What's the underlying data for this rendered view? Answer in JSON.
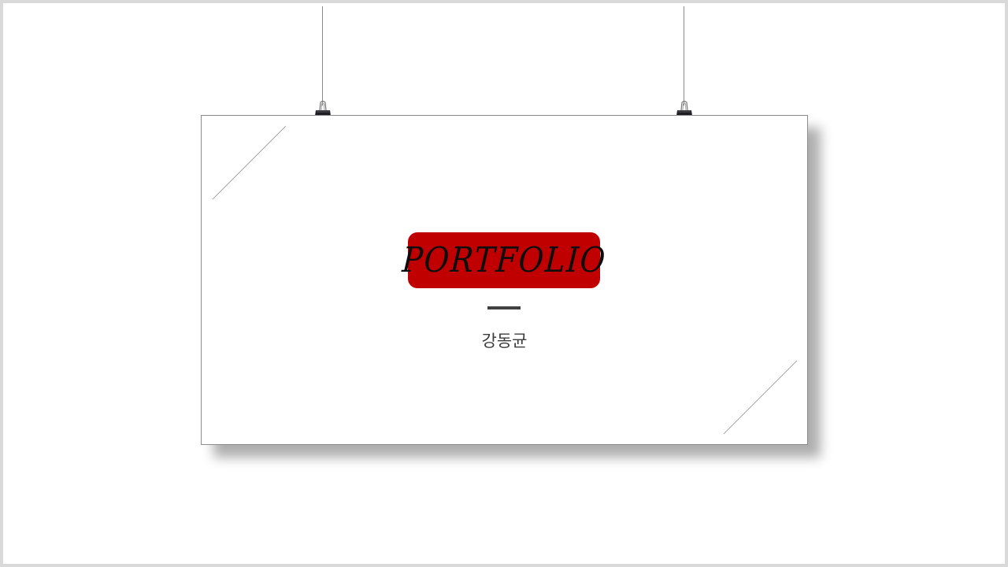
{
  "poster": {
    "title": "PORTFOLIO",
    "author": "강동균"
  },
  "icons": {
    "clips": [
      "binder-clip-icon",
      "binder-clip-icon"
    ]
  },
  "colors": {
    "badge": "#c00000",
    "badge_text": "#0d0d0d",
    "rule": "#404040",
    "frame_border": "#d9d9d9"
  }
}
